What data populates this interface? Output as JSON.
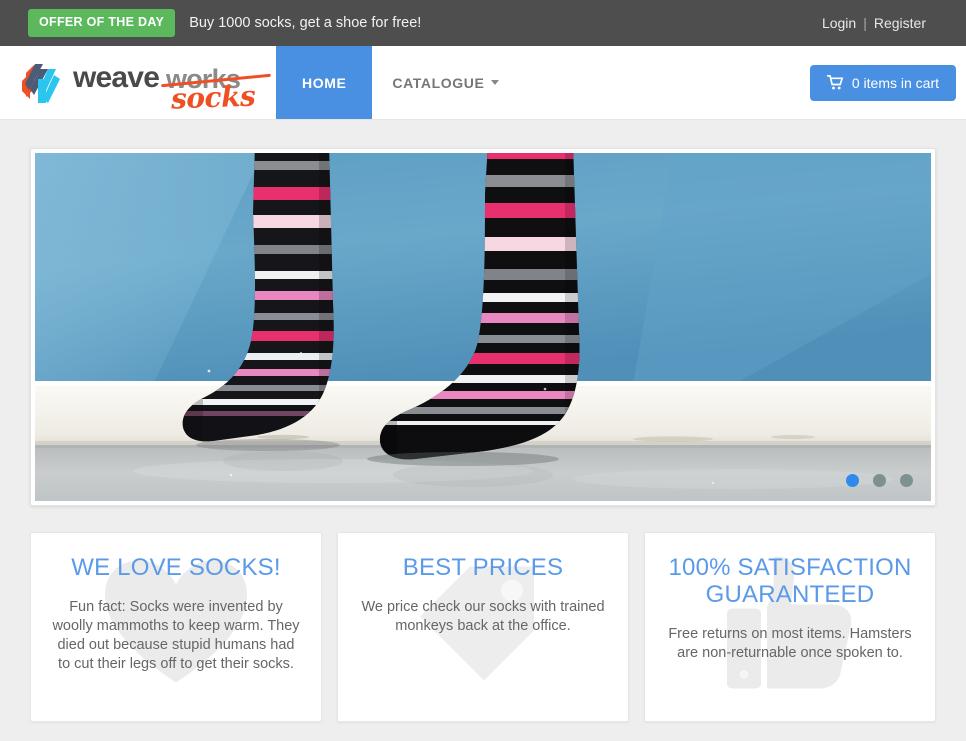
{
  "offer_bar": {
    "badge_label": "OFFER OF THE DAY",
    "message": "Buy 1000 socks, get a shoe for free!",
    "login_label": "Login",
    "separator": "|",
    "register_label": "Register",
    "background_color": "#4e4e4e",
    "badge_color": "#5cb85c"
  },
  "header": {
    "brand": {
      "weave_text": "weave",
      "works_text": "works",
      "socks_text": "socks",
      "logo_icon": "weaveworks-logo-icon",
      "strikethrough_color": "#f04e23",
      "socks_color": "#f04e23",
      "weave_color": "#4a4a4a",
      "works_color": "#8a8a8a"
    },
    "nav": [
      {
        "label": "HOME",
        "active": true
      },
      {
        "label": "CATALOGUE",
        "active": false,
        "has_dropdown": true
      }
    ],
    "cart": {
      "label": "0 items in cart",
      "count": 0,
      "icon": "shopping-cart-icon",
      "color": "#4a90e2"
    }
  },
  "carousel": {
    "slide_alt": "Striped socks on feet against a blue wall",
    "dots": [
      {
        "index": 1,
        "active": true
      },
      {
        "index": 2,
        "active": false
      },
      {
        "index": 3,
        "active": false
      }
    ],
    "active_dot_color": "#2f8bea",
    "inactive_dot_color": "#7e9191"
  },
  "feature_cards": [
    {
      "title": "WE LOVE SOCKS!",
      "body": "Fun fact: Socks were invented by woolly mammoths to keep warm. They died out because stupid humans had to cut their legs off to get their socks.",
      "watermark_icon": "heart-icon"
    },
    {
      "title": "BEST PRICES",
      "body": "We price check our socks with trained monkeys back at the office.",
      "watermark_icon": "price-tag-icon"
    },
    {
      "title": "100% SATISFACTION GUARANTEED",
      "body": "Free returns on most items. Hamsters are non-returnable once spoken to.",
      "watermark_icon": "thumbs-up-icon"
    }
  ],
  "theme": {
    "page_background": "#eeeeee",
    "accent_blue": "#4a90e2",
    "heading_blue": "#5b9ae8",
    "body_text": "#666666"
  }
}
